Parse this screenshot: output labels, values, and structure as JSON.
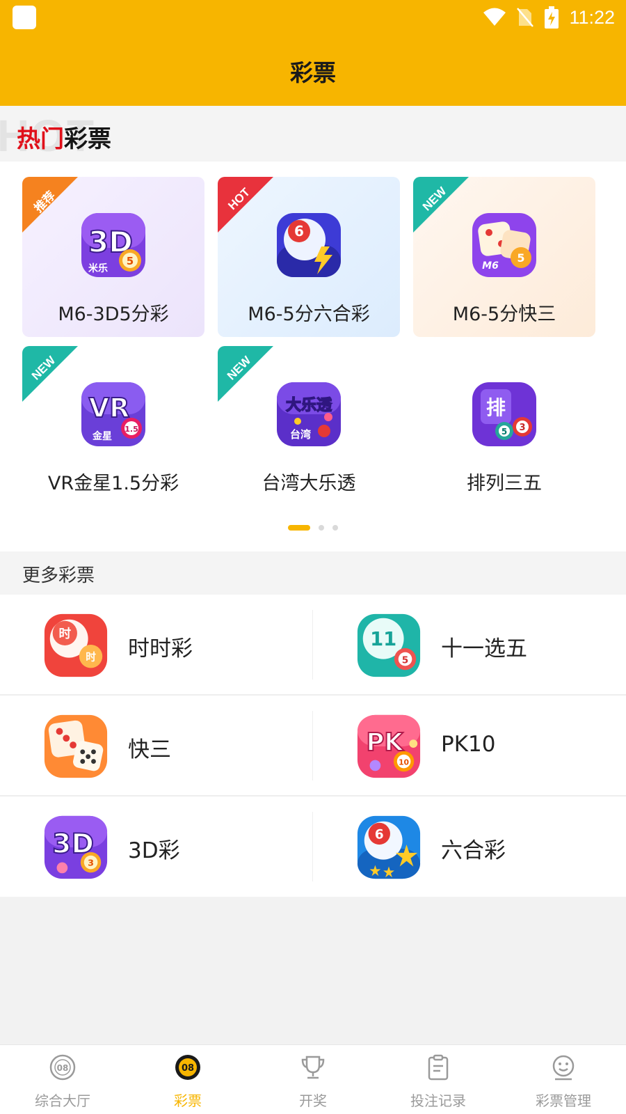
{
  "status_bar": {
    "time": "11:22"
  },
  "header": {
    "title": "彩票"
  },
  "hot_section": {
    "watermark": "HOT",
    "title_red": "热门",
    "title_dark": "彩票",
    "cards": [
      {
        "name": "M6-3D5分彩",
        "badge": "推荐",
        "icon": "3d-lottery-icon",
        "icon_text": "3D"
      },
      {
        "name": "M6-5分六合彩",
        "badge": "HOT",
        "icon": "six-ball-icon",
        "icon_text": "6"
      },
      {
        "name": "M6-5分快三",
        "badge": "NEW",
        "icon": "dice-icon",
        "icon_text": "5"
      },
      {
        "name": "VR金星1.5分彩",
        "badge": "NEW",
        "icon": "vr-lottery-icon",
        "icon_text": "VR"
      },
      {
        "name": "台湾大乐透",
        "badge": "NEW",
        "icon": "lotto-icon",
        "icon_text": "大乐透"
      },
      {
        "name": "排列三五",
        "badge": "",
        "icon": "pailie-icon",
        "icon_text": "排"
      }
    ],
    "page_indicator": {
      "pages": 3,
      "current": 1
    }
  },
  "more_section": {
    "title": "更多彩票",
    "items": [
      {
        "label": "时时彩",
        "icon": "shishicai-icon",
        "icon_text": "时"
      },
      {
        "label": "十一选五",
        "icon": "eleven-pick-five-icon",
        "icon_text": "11"
      },
      {
        "label": "快三",
        "icon": "dice-icon",
        "icon_text": ""
      },
      {
        "label": "PK10",
        "icon": "pk10-icon",
        "icon_text": "PK"
      },
      {
        "label": "3D彩",
        "icon": "3d-lottery-icon",
        "icon_text": "3D"
      },
      {
        "label": "六合彩",
        "icon": "six-ball-icon",
        "icon_text": "6"
      }
    ]
  },
  "bottom_nav": {
    "items": [
      {
        "label": "综合大厅",
        "icon": "lobby-icon",
        "active": false
      },
      {
        "label": "彩票",
        "icon": "lottery-icon",
        "active": true
      },
      {
        "label": "开奖",
        "icon": "trophy-icon",
        "active": false
      },
      {
        "label": "投注记录",
        "icon": "clipboard-icon",
        "active": false
      },
      {
        "label": "彩票管理",
        "icon": "smiley-icon",
        "active": false
      }
    ]
  },
  "colors": {
    "brand_yellow": "#f7b500",
    "badge_recommend": "#f5821f",
    "badge_hot": "#e8323c",
    "badge_new": "#1fb8a6"
  }
}
